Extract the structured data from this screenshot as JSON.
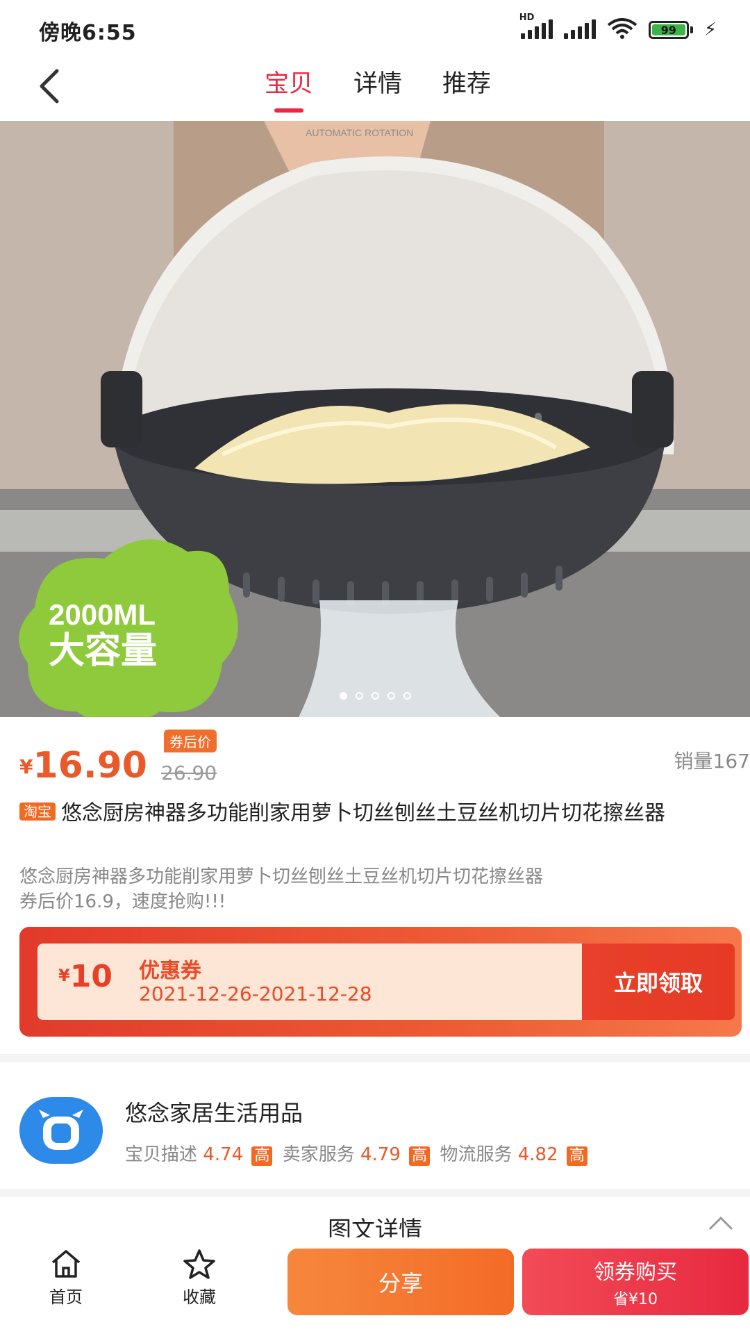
{
  "status_bar": {
    "time": "傍晚6:55",
    "battery": "99",
    "network_label": "HD"
  },
  "nav": {
    "tabs": [
      {
        "label": "宝贝",
        "active": true
      },
      {
        "label": "详情"
      },
      {
        "label": "推荐"
      }
    ]
  },
  "product": {
    "image_badge": {
      "line1": "2000ML",
      "line2": "大容量"
    },
    "watermark": "AUTOMATIC ROTATION",
    "image_count": 5,
    "image_current": 1,
    "currency": "¥",
    "price": "16.90",
    "coupon_tag": "券后价",
    "original_price": "26.90",
    "sales": "销量167",
    "platform": "淘宝",
    "title": "悠念厨房神器多功能削家用萝卜切丝刨丝土豆丝机切片切花擦丝器",
    "desc_line1": "悠念厨房神器多功能削家用萝卜切丝刨丝土豆丝机切片切花擦丝器",
    "desc_line2": "券后价16.9，速度抢购!!!"
  },
  "coupon": {
    "currency": "¥",
    "amount": "10",
    "name": "优惠券",
    "date": "2021-12-26-2021-12-28",
    "action": "立即领取"
  },
  "shop": {
    "name": "悠念家居生活用品",
    "scores": [
      {
        "label": "宝贝描述",
        "value": "4.74",
        "level": "高"
      },
      {
        "label": "卖家服务",
        "value": "4.79",
        "level": "高"
      },
      {
        "label": "物流服务",
        "value": "4.82",
        "level": "高"
      }
    ]
  },
  "detail": {
    "title": "图文详情"
  },
  "bottom": {
    "home": "首页",
    "favorite": "收藏",
    "share": "分享",
    "buy": "领券购买",
    "save": "省¥10"
  },
  "colors": {
    "accent": "#e8293f",
    "price": "#e9592a",
    "coupon_bg": "#e23a2b",
    "share_btn": "#f36b27"
  }
}
